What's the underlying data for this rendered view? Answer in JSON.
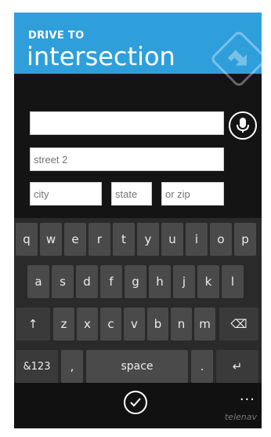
{
  "header": {
    "eyebrow": "DRIVE TO",
    "title": "intersection",
    "logo_icon": "telenav-logo-icon"
  },
  "form": {
    "street1": {
      "value": "",
      "placeholder": ""
    },
    "street2": {
      "value": "",
      "placeholder": "street 2"
    },
    "city": {
      "value": "",
      "placeholder": "city"
    },
    "state": {
      "value": "",
      "placeholder": "state"
    },
    "zip": {
      "value": "",
      "placeholder": "or zip"
    },
    "voice_icon": "microphone-icon"
  },
  "keyboard": {
    "row1": [
      "q",
      "w",
      "e",
      "r",
      "t",
      "y",
      "u",
      "i",
      "o",
      "p"
    ],
    "row2": [
      "a",
      "s",
      "d",
      "f",
      "g",
      "h",
      "j",
      "k",
      "l"
    ],
    "row3": [
      "↑",
      "z",
      "x",
      "c",
      "v",
      "b",
      "n",
      "m",
      "⌫"
    ],
    "row4": [
      "&123",
      ",",
      "space",
      ".",
      "↵"
    ]
  },
  "footer": {
    "confirm_icon": "checkmark-icon",
    "more": "...",
    "brand": "telenav"
  },
  "colors": {
    "header": "#2f9fdc",
    "background": "#141414",
    "keyboard": "#2a2a2a",
    "key": "#4a4a4a"
  }
}
